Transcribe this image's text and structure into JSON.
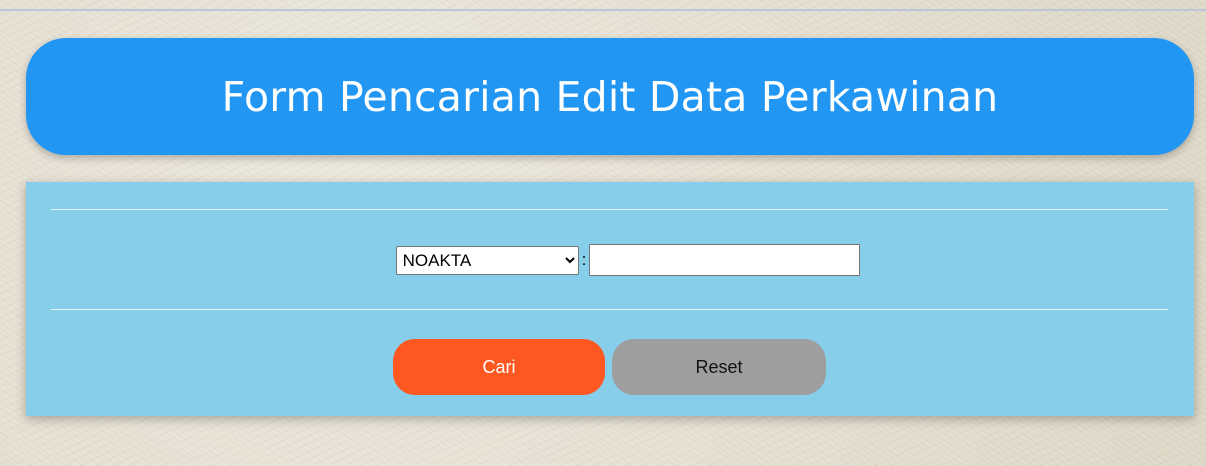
{
  "header": {
    "title": "Form Pencarian Edit Data Perkawinan"
  },
  "search": {
    "field_selected": "NOAKTA",
    "field_options": [
      "NOAKTA"
    ],
    "separator": ":",
    "value": "",
    "placeholder": ""
  },
  "buttons": {
    "search_label": "Cari",
    "reset_label": "Reset"
  },
  "colors": {
    "header_bg": "#2196f3",
    "panel_bg": "#87ceeb",
    "search_button_bg": "#ff5722",
    "reset_button_bg": "#9e9e9e"
  }
}
